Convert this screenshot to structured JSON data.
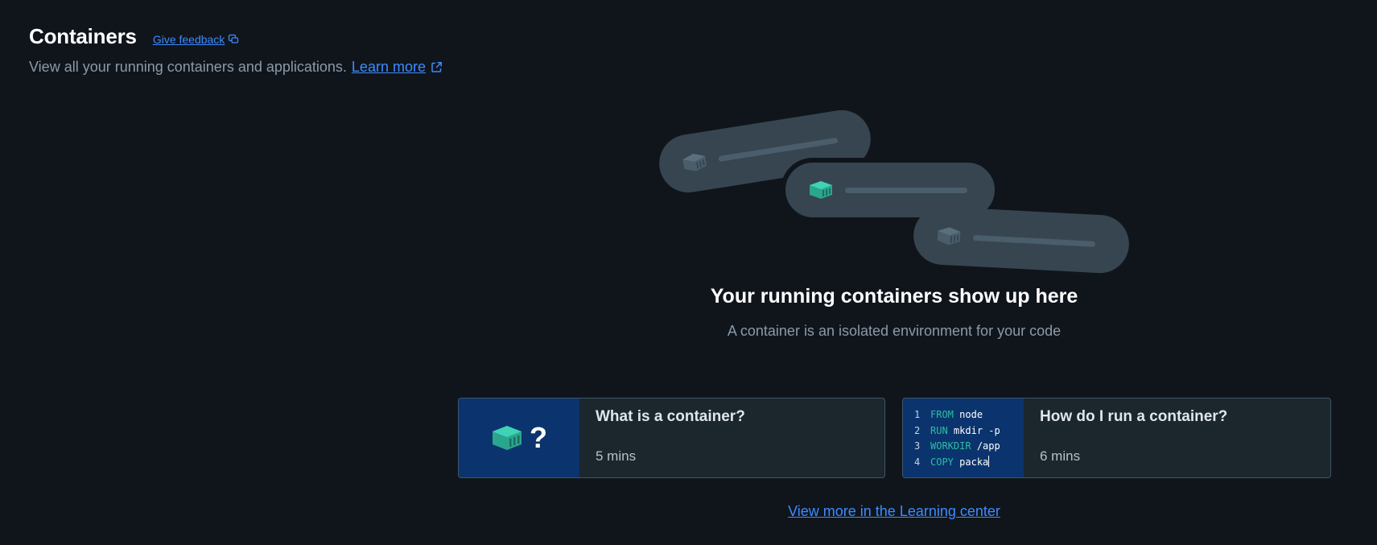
{
  "header": {
    "title": "Containers",
    "feedback_label": "Give feedback",
    "subtitle": "View all your running containers and applications.",
    "learn_more_label": "Learn more"
  },
  "empty_state": {
    "title": "Your running containers show up here",
    "subtitle": "A container is an isolated environment for your code"
  },
  "cards": [
    {
      "title": "What is a container?",
      "duration": "5 mins",
      "thumb_symbol": "?"
    },
    {
      "title": "How do I run a container?",
      "duration": "6 mins",
      "code_lines": [
        {
          "n": "1",
          "kw": "FROM",
          "text": "node"
        },
        {
          "n": "2",
          "kw": "RUN",
          "text": "mkdir -p"
        },
        {
          "n": "3",
          "kw": "WORKDIR",
          "text": "/app"
        },
        {
          "n": "4",
          "kw": "COPY",
          "text": "packa"
        }
      ]
    }
  ],
  "learning_center_label": "View more in the Learning center",
  "colors": {
    "background": "#10151c",
    "link": "#3d8bff",
    "accent_teal": "#2fbda2",
    "card_thumb": "#0b346e"
  }
}
